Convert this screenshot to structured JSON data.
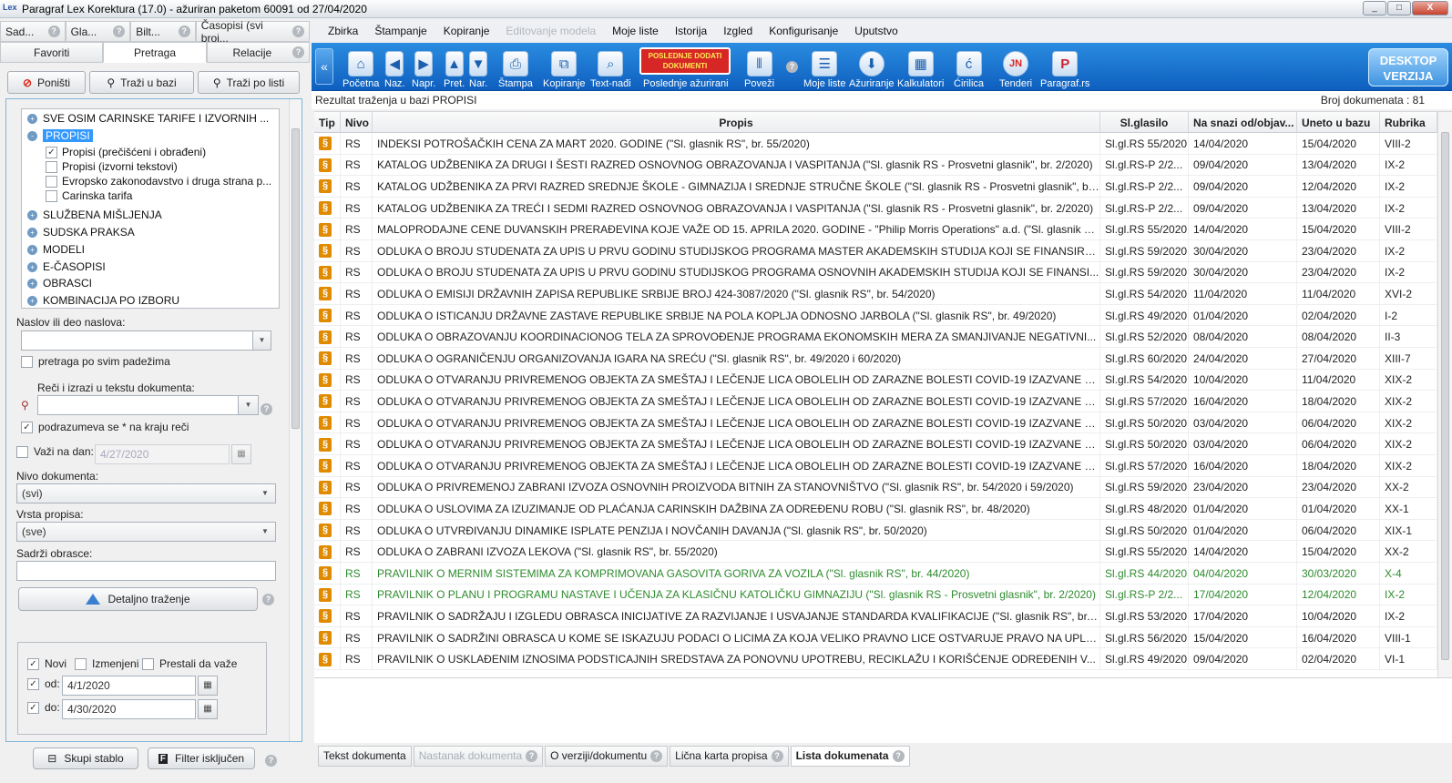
{
  "window": {
    "app_icon": "Lex",
    "title": "Paragraf Lex Korektura (17.0)  - ažuriran paketom 60091 od 27/04/2020",
    "controls": [
      "_",
      "□",
      "X"
    ]
  },
  "left_panel": {
    "top_tabs": [
      {
        "label": "Sad..."
      },
      {
        "label": "Gla..."
      },
      {
        "label": "Bilt..."
      },
      {
        "label": "Časopisi (svi broj..."
      }
    ],
    "sub_tabs": [
      {
        "label": "Favoriti"
      },
      {
        "label": "Pretraga"
      },
      {
        "label": "Relacije"
      }
    ],
    "search_buttons": {
      "cancel": "Poništi",
      "search_db": "Traži u bazi",
      "search_list": "Traži po listi"
    },
    "tree": {
      "nodes": [
        {
          "label": "SVE OSIM CARINSKE TARIFE I IZVORNIH ...",
          "expander": "+"
        },
        {
          "label": "PROPISI",
          "expander": "-"
        }
      ],
      "children": [
        {
          "label": "Propisi (prečišćeni i obrađeni)",
          "checked": "✓"
        },
        {
          "label": "Propisi (izvorni tekstovi)",
          "checked": ""
        },
        {
          "label": "Evropsko zakonodavstvo i druga strana p...",
          "checked": ""
        },
        {
          "label": "Carinska tarifa",
          "checked": ""
        }
      ],
      "more_nodes": [
        {
          "label": "SLUŽBENA MIŠLJENJA",
          "expander": "+"
        },
        {
          "label": "SUDSKA PRAKSA",
          "expander": "+"
        },
        {
          "label": "MODELI",
          "expander": "+"
        },
        {
          "label": "E-ČASOPISI",
          "expander": "+"
        },
        {
          "label": "OBRASCI",
          "expander": "+"
        },
        {
          "label": "KOMBINACIJA PO IZBORU",
          "expander": "+"
        }
      ]
    },
    "form": {
      "title_label": "Naslov ili deo naslova:",
      "title_value": "",
      "all_cases_label": "pretraga po svim padežima",
      "words_label": "Reči i izrazi u tekstu dokumenta:",
      "words_value": "",
      "wildcard_label": "podrazumeva se * na kraju reči",
      "valid_on_label": "Važi na dan:",
      "valid_on_value": "4/27/2020",
      "level_label": "Nivo dokumenta:",
      "level_value": "(svi)",
      "type_label": "Vrsta propisa:",
      "type_value": "(sve)",
      "forms_label": "Sadrži obrasce:",
      "forms_value": "",
      "detailed_button": "Detaljno traženje",
      "new_label": "Novi",
      "changed_label": "Izmenjeni",
      "expired_label": "Prestali da važe",
      "from_label": "od:",
      "from_value": "4/1/2020",
      "to_label": "do:",
      "to_value": "4/30/2020"
    },
    "bottom_buttons": {
      "collapse": "Skupi stablo",
      "filter": "Filter isključen"
    }
  },
  "menu": [
    {
      "label": "Zbirka"
    },
    {
      "label": "Štampanje"
    },
    {
      "label": "Kopiranje"
    },
    {
      "label": "Editovanje modela"
    },
    {
      "label": "Moje liste"
    },
    {
      "label": "Istorija"
    },
    {
      "label": "Izgled"
    },
    {
      "label": "Konfigurisanje"
    },
    {
      "label": "Uputstvo"
    }
  ],
  "toolbar": {
    "items": [
      {
        "label": "Početna"
      },
      {
        "label": "Naz."
      },
      {
        "label": "Napr."
      },
      {
        "label": "Pret."
      },
      {
        "label": "Nar."
      },
      {
        "label": "Štampa"
      },
      {
        "label": "Kopiranje"
      },
      {
        "label": "Text-nađi"
      },
      {
        "label": "Poslednje ažurirani"
      },
      {
        "label": "Poveži"
      },
      {
        "label": "Moje liste"
      },
      {
        "label": "Ažuriranje"
      },
      {
        "label": "Kalkulatori"
      },
      {
        "label": "Ćirilica"
      },
      {
        "label": "Tenderi"
      },
      {
        "label": "Paragraf.rs"
      }
    ],
    "latest_badge": "POSLEDNJE DODATI DOKUMENTI",
    "desktop_badge": "DESKTOP VERZIJA",
    "icon_glyphs": {
      "home": "⌂",
      "prev": "◀",
      "next": "▶",
      "up": "▲",
      "down": "▼",
      "print": "⎙",
      "copy": "⧉",
      "find": "⌕",
      "link": "⫴",
      "lists": "☰",
      "update": "⬇",
      "calc": "▦",
      "cyr": "ć",
      "tender": "JN",
      "web": "P"
    }
  },
  "results": {
    "info": "Rezultat traženja u bazi PROPISI",
    "count_label": "Broj dokumenata : 81",
    "columns": [
      "Tip",
      "Nivo",
      "Propis",
      "Sl.glasilo",
      "Na snazi od/objav...",
      "Uneto u bazu",
      "Rubrika"
    ],
    "rows": [
      {
        "tip": "§",
        "nivo": "RS",
        "propis": "INDEKSI POTROŠAČKIH CENA ZA MART 2020. GODINE (\"Sl. glasnik RS\", br. 55/2020)",
        "glasilo": "Sl.gl.RS 55/2020",
        "na_snazi": "14/04/2020",
        "uneto": "15/04/2020",
        "rubrika": "VIII-2",
        "green": false
      },
      {
        "tip": "§",
        "nivo": "RS",
        "propis": "KATALOG UDŽBENIKA ZA DRUGI I ŠESTI RAZRED OSNOVNOG OBRAZOVANJA I VASPITANJA (\"Sl. glasnik RS - Prosvetni glasnik\", br. 2/2020)",
        "glasilo": "Sl.gl.RS-P 2/2...",
        "na_snazi": "09/04/2020",
        "uneto": "13/04/2020",
        "rubrika": "IX-2",
        "green": false
      },
      {
        "tip": "§",
        "nivo": "RS",
        "propis": "KATALOG UDŽBENIKA ZA PRVI RAZRED SREDNJE ŠKOLE - GIMNAZIJA I SREDNJE STRUČNE ŠKOLE (\"Sl. glasnik RS - Prosvetni glasnik\", br....",
        "glasilo": "Sl.gl.RS-P 2/2...",
        "na_snazi": "09/04/2020",
        "uneto": "12/04/2020",
        "rubrika": "IX-2",
        "green": false
      },
      {
        "tip": "§",
        "nivo": "RS",
        "propis": "KATALOG UDŽBENIKA ZA TREĆI I SEDMI RAZRED OSNOVNOG OBRAZOVANJA I VASPITANJA (\"Sl. glasnik RS - Prosvetni glasnik\", br. 2/2020)",
        "glasilo": "Sl.gl.RS-P 2/2...",
        "na_snazi": "09/04/2020",
        "uneto": "13/04/2020",
        "rubrika": "IX-2",
        "green": false
      },
      {
        "tip": "§",
        "nivo": "RS",
        "propis": "MALOPRODAJNE CENE DUVANSKIH PRERAĐEVINA KOJE VAŽE OD 15. APRILA 2020. GODINE - \"Philip Morris Operations\" a.d. (\"Sl. glasnik R...",
        "glasilo": "Sl.gl.RS 55/2020",
        "na_snazi": "14/04/2020",
        "uneto": "15/04/2020",
        "rubrika": "VIII-2",
        "green": false
      },
      {
        "tip": "§",
        "nivo": "RS",
        "propis": "ODLUKA O BROJU STUDENATA ZA UPIS U PRVU GODINU STUDIJSKOG PROGRAMA MASTER AKADEMSKIH STUDIJA KOJI SE FINANSIRA...",
        "glasilo": "Sl.gl.RS 59/2020",
        "na_snazi": "30/04/2020",
        "uneto": "23/04/2020",
        "rubrika": "IX-2",
        "green": false
      },
      {
        "tip": "§",
        "nivo": "RS",
        "propis": "ODLUKA O BROJU STUDENATA ZA UPIS U PRVU GODINU STUDIJSKOG PROGRAMA OSNOVNIH AKADEMSKIH STUDIJA KOJI SE FINANSI...",
        "glasilo": "Sl.gl.RS 59/2020",
        "na_snazi": "30/04/2020",
        "uneto": "23/04/2020",
        "rubrika": "IX-2",
        "green": false
      },
      {
        "tip": "§",
        "nivo": "RS",
        "propis": "ODLUKA O EMISIJI DRŽAVNIH ZAPISA REPUBLIKE SRBIJE BROJ 424-3087/2020 (\"Sl. glasnik RS\", br. 54/2020)",
        "glasilo": "Sl.gl.RS 54/2020",
        "na_snazi": "11/04/2020",
        "uneto": "11/04/2020",
        "rubrika": "XVI-2",
        "green": false
      },
      {
        "tip": "§",
        "nivo": "RS",
        "propis": "ODLUKA O ISTICANJU DRŽAVNE ZASTAVE REPUBLIKE SRBIJE NA POLA KOPLJA ODNOSNO JARBOLA (\"Sl. glasnik RS\", br. 49/2020)",
        "glasilo": "Sl.gl.RS 49/2020",
        "na_snazi": "01/04/2020",
        "uneto": "02/04/2020",
        "rubrika": "I-2",
        "green": false
      },
      {
        "tip": "§",
        "nivo": "RS",
        "propis": "ODLUKA O OBRAZOVANJU KOORDINACIONOG TELA ZA SPROVOĐENJE PROGRAMA EKONOMSKIH MERA ZA SMANJIVANJE NEGATIVNI...",
        "glasilo": "Sl.gl.RS 52/2020",
        "na_snazi": "08/04/2020",
        "uneto": "08/04/2020",
        "rubrika": "II-3",
        "green": false
      },
      {
        "tip": "§",
        "nivo": "RS",
        "propis": "ODLUKA O OGRANIČENJU ORGANIZOVANJA IGARA NA SREĆU (\"Sl. glasnik RS\", br. 49/2020 i 60/2020)",
        "glasilo": "Sl.gl.RS 60/2020",
        "na_snazi": "24/04/2020",
        "uneto": "27/04/2020",
        "rubrika": "XIII-7",
        "green": false
      },
      {
        "tip": "§",
        "nivo": "RS",
        "propis": "ODLUKA O OTVARANJU PRIVREMENOG OBJEKTA ZA SMEŠTAJ I LEČENJE LICA OBOLELIH OD ZARAZNE BOLESTI COVID-19 IZAZVANE V...",
        "glasilo": "Sl.gl.RS 54/2020",
        "na_snazi": "10/04/2020",
        "uneto": "11/04/2020",
        "rubrika": "XIX-2",
        "green": false
      },
      {
        "tip": "§",
        "nivo": "RS",
        "propis": "ODLUKA O OTVARANJU PRIVREMENOG OBJEKTA ZA SMEŠTAJ I LEČENJE LICA OBOLELIH OD ZARAZNE BOLESTI COVID-19 IZAZVANE V...",
        "glasilo": "Sl.gl.RS 57/2020",
        "na_snazi": "16/04/2020",
        "uneto": "18/04/2020",
        "rubrika": "XIX-2",
        "green": false
      },
      {
        "tip": "§",
        "nivo": "RS",
        "propis": "ODLUKA O OTVARANJU PRIVREMENOG OBJEKTA ZA SMEŠTAJ I LEČENJE LICA OBOLELIH OD ZARAZNE BOLESTI COVID-19 IZAZVANE V...",
        "glasilo": "Sl.gl.RS 50/2020",
        "na_snazi": "03/04/2020",
        "uneto": "06/04/2020",
        "rubrika": "XIX-2",
        "green": false
      },
      {
        "tip": "§",
        "nivo": "RS",
        "propis": "ODLUKA O OTVARANJU PRIVREMENOG OBJEKTA ZA SMEŠTAJ I LEČENJE LICA OBOLELIH OD ZARAZNE BOLESTI COVID-19 IZAZVANE V...",
        "glasilo": "Sl.gl.RS 50/2020",
        "na_snazi": "03/04/2020",
        "uneto": "06/04/2020",
        "rubrika": "XIX-2",
        "green": false
      },
      {
        "tip": "§",
        "nivo": "RS",
        "propis": "ODLUKA O OTVARANJU PRIVREMENOG OBJEKTA ZA SMEŠTAJ I LEČENJE LICA OBOLELIH OD ZARAZNE BOLESTI COVID-19 IZAZVANE V...",
        "glasilo": "Sl.gl.RS 57/2020",
        "na_snazi": "16/04/2020",
        "uneto": "18/04/2020",
        "rubrika": "XIX-2",
        "green": false
      },
      {
        "tip": "§",
        "nivo": "RS",
        "propis": "ODLUKA O PRIVREMENOJ ZABRANI IZVOZA OSNOVNIH PROIZVODA BITNIH ZA STANOVNIŠTVO (\"Sl. glasnik RS\", br. 54/2020 i 59/2020)",
        "glasilo": "Sl.gl.RS 59/2020",
        "na_snazi": "23/04/2020",
        "uneto": "23/04/2020",
        "rubrika": "XX-2",
        "green": false
      },
      {
        "tip": "§",
        "nivo": "RS",
        "propis": "ODLUKA O USLOVIMA ZA IZUZIMANJE OD PLAĆANJA CARINSKIH DAŽBINA ZA ODREĐENU ROBU (\"Sl. glasnik RS\", br. 48/2020)",
        "glasilo": "Sl.gl.RS 48/2020",
        "na_snazi": "01/04/2020",
        "uneto": "01/04/2020",
        "rubrika": "XX-1",
        "green": false
      },
      {
        "tip": "§",
        "nivo": "RS",
        "propis": "ODLUKA O UTVRĐIVANJU DINAMIKE ISPLATE PENZIJA I NOVČANIH DAVANJA (\"Sl. glasnik RS\", br. 50/2020)",
        "glasilo": "Sl.gl.RS 50/2020",
        "na_snazi": "01/04/2020",
        "uneto": "06/04/2020",
        "rubrika": "XIX-1",
        "green": false
      },
      {
        "tip": "§",
        "nivo": "RS",
        "propis": "ODLUKA O ZABRANI IZVOZA LEKOVA (\"Sl. glasnik RS\", br. 55/2020)",
        "glasilo": "Sl.gl.RS 55/2020",
        "na_snazi": "14/04/2020",
        "uneto": "15/04/2020",
        "rubrika": "XX-2",
        "green": false
      },
      {
        "tip": "§",
        "nivo": "RS",
        "propis": "PRAVILNIK O MERNIM SISTEMIMA ZA KOMPRIMOVANA GASOVITA GORIVA ZA VOZILA (\"Sl. glasnik RS\", br. 44/2020)",
        "glasilo": "Sl.gl.RS 44/2020",
        "na_snazi": "04/04/2020",
        "uneto": "30/03/2020",
        "rubrika": "X-4",
        "green": true
      },
      {
        "tip": "§",
        "nivo": "RS",
        "propis": "PRAVILNIK O PLANU I PROGRAMU NASTAVE I UČENJA ZA KLASIČNU KATOLIČKU GIMNAZIJU (\"Sl. glasnik RS - Prosvetni glasnik\", br. 2/2020)",
        "glasilo": "Sl.gl.RS-P 2/2...",
        "na_snazi": "17/04/2020",
        "uneto": "12/04/2020",
        "rubrika": "IX-2",
        "green": true
      },
      {
        "tip": "§",
        "nivo": "RS",
        "propis": "PRAVILNIK O SADRŽAJU I IZGLEDU OBRASCA INICIJATIVE ZA RAZVIJANJE I USVAJANJE STANDARDA KVALIFIKACIJE (\"Sl. glasnik RS\", br. ...",
        "glasilo": "Sl.gl.RS 53/2020",
        "na_snazi": "17/04/2020",
        "uneto": "10/04/2020",
        "rubrika": "IX-2",
        "green": false
      },
      {
        "tip": "§",
        "nivo": "RS",
        "propis": "PRAVILNIK O SADRŽINI OBRASCA U KOME SE ISKAZUJU PODACI O LICIMA ZA KOJA VELIKO PRAVNO LICE OSTVARUJE PRAVO NA UPLA...",
        "glasilo": "Sl.gl.RS 56/2020",
        "na_snazi": "15/04/2020",
        "uneto": "16/04/2020",
        "rubrika": "VIII-1",
        "green": false
      },
      {
        "tip": "§",
        "nivo": "RS",
        "propis": "PRAVILNIK O USKLAĐENIM IZNOSIMA PODSTICAJNIH SREDSTAVA ZA PONOVNU UPOTREBU, RECIKLAŽU I KORIŠĆENJE ODREĐENIH V...",
        "glasilo": "Sl.gl.RS 49/2020",
        "na_snazi": "09/04/2020",
        "uneto": "02/04/2020",
        "rubrika": "VI-1",
        "green": false
      }
    ]
  },
  "bottom_tabs": [
    {
      "label": "Tekst dokumenta"
    },
    {
      "label": "Nastanak dokumenta"
    },
    {
      "label": "O verziji/dokumentu"
    },
    {
      "label": "Lična karta propisa"
    },
    {
      "label": "Lista dokumenata"
    }
  ],
  "colors": {
    "toolbar": "#1473d0",
    "selection": "#3399ff",
    "green_row": "#2e8b2e",
    "doc_icon": "#e08a00"
  }
}
